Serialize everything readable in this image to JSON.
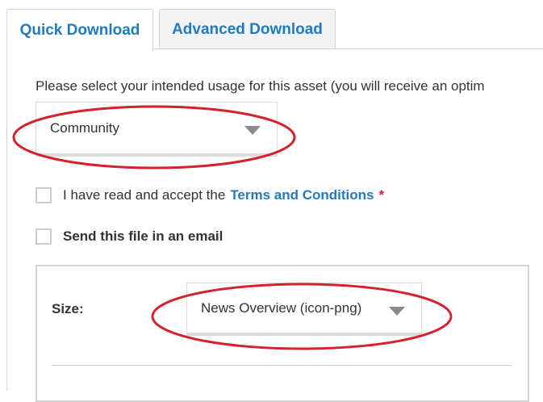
{
  "tabs": [
    {
      "label": "Quick Download",
      "active": true
    },
    {
      "label": "Advanced Download",
      "active": false
    }
  ],
  "intro_text": "Please select your intended usage for this asset (you will receive an optim",
  "usage_select": {
    "value": "Community"
  },
  "terms": {
    "prefix": "I have read and accept the",
    "link": "Terms and Conditions",
    "required_mark": "*",
    "checked": false
  },
  "email": {
    "label": "Send this file in an email",
    "checked": false
  },
  "size": {
    "label": "Size:",
    "value": "News Overview (icon-png)"
  },
  "colors": {
    "accent": "#1f7bbf",
    "required": "#d0203a",
    "annotation": "#d6202e"
  }
}
